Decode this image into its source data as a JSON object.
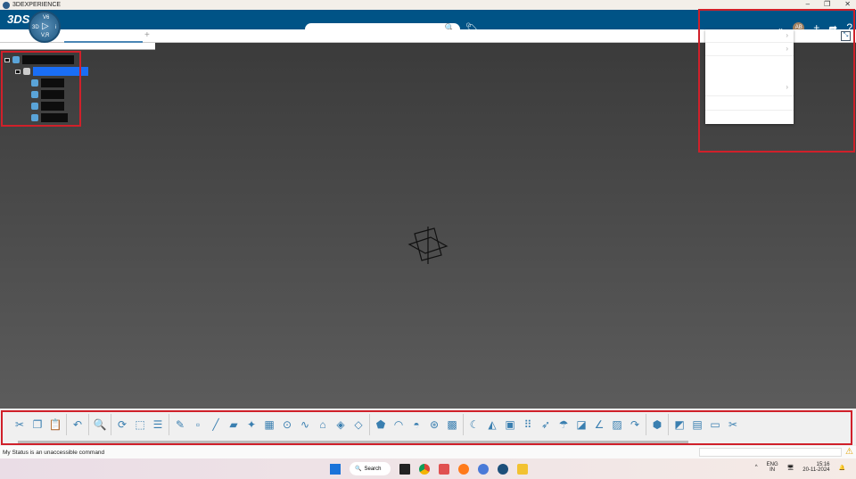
{
  "window": {
    "title": "3DEXPERIENCE",
    "controls": [
      "–",
      "❐",
      "✕"
    ]
  },
  "topbar": {
    "brand": "3DS",
    "compass": {
      "top": "V6",
      "left": "3D",
      "right": "i",
      "bottom": "V,R"
    },
    "search_placeholder": "",
    "avatar_initials": "AB"
  },
  "tabs": {
    "add": "+"
  },
  "status": {
    "text": "My Status is an unaccessible command"
  },
  "taskbar": {
    "search_label": "Search",
    "lang": "ENG",
    "region": "IN",
    "time": "15:16",
    "date": "20-11-2024"
  },
  "toolbar": {
    "icons": [
      "cut-icon",
      "copy-icon",
      "paste-icon",
      "|",
      "undo-icon",
      "|",
      "fit-all-icon",
      "|",
      "rotate-icon",
      "view-cube-icon",
      "layers-icon",
      "|",
      "sketch-icon",
      "point-icon",
      "line-icon",
      "plane-icon",
      "axis-system-icon",
      "grid-icon",
      "circle-icon",
      "spline-icon",
      "extrude-icon",
      "revolve-icon",
      "sweep-icon",
      "|",
      "multi-section-icon",
      "fill-icon",
      "offset-icon",
      "blend-icon",
      "join-icon",
      "|",
      "pattern-icon",
      "split-icon",
      "symmetry-icon",
      "measure-icon",
      "array-icon",
      "project-icon",
      "umbrella-icon",
      "extract-icon",
      "curve-icon",
      "mesh-icon",
      "|",
      "fillet-icon",
      "|",
      "part-icon",
      "assembly-icon",
      "catalog-icon",
      "folder-icon"
    ]
  },
  "colors": {
    "brand": "#005386",
    "highlight": "#1a6ef5",
    "annotation": "#d0202a"
  }
}
